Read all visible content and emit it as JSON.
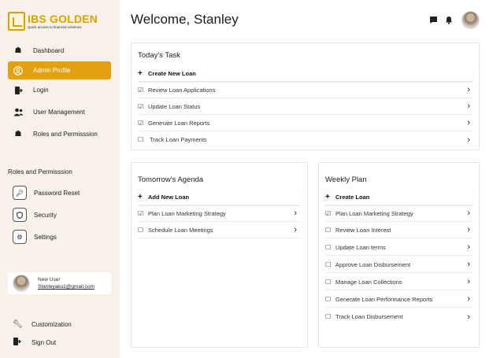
{
  "brand": {
    "title": "IBS GOLDEN",
    "tagline": "Quick access to financial solutions",
    "accent": "#e3a010"
  },
  "sidebar": {
    "items": [
      {
        "label": "Dashboard",
        "icon": "home-icon"
      },
      {
        "label": "Admin Profile",
        "icon": "user-circle-icon",
        "active": true
      },
      {
        "label": "Login",
        "icon": "login-icon"
      },
      {
        "label": "User Management",
        "icon": "users-icon"
      },
      {
        "label": "Roles and Permisssion",
        "icon": "home-icon"
      }
    ],
    "section_label": "Roles and Permisssion",
    "sub_items": [
      {
        "label": "Password Reset",
        "icon": "key-icon"
      },
      {
        "label": "Security",
        "icon": "shield-icon"
      },
      {
        "label": "Settings",
        "icon": "gear-icon"
      }
    ],
    "user": {
      "name": "New User",
      "email": "Stanleyaku1@gmail.com"
    },
    "bottom_items": [
      {
        "label": "Customization",
        "icon": "wrench-icon"
      },
      {
        "label": "Sign Out",
        "icon": "logout-icon"
      }
    ]
  },
  "header": {
    "welcome": "Welcome, Stanley"
  },
  "today": {
    "title": "Today's Task",
    "create": "Create New Loan",
    "tasks": [
      {
        "label": "Review Loan Applications",
        "checked": true
      },
      {
        "label": "Update Loan Status",
        "checked": true
      },
      {
        "label": "Generate Loan Reports",
        "checked": true
      },
      {
        "label": "Track Loan Payments",
        "checked": false
      }
    ]
  },
  "tomorrow": {
    "title": "Tomorrow's Agenda",
    "create": "Add New Loan",
    "tasks": [
      {
        "label": "Plan Loan Marketing Strategy",
        "checked": true
      },
      {
        "label": "Schedule Loan Meetings",
        "checked": false
      }
    ]
  },
  "weekly": {
    "title": "Weekly Plan",
    "create": "Create Loan",
    "tasks": [
      {
        "label": "Plan Loan Marketing Strategy",
        "checked": true
      },
      {
        "label": "Review Loan Interest",
        "checked": false
      },
      {
        "label": "Update Loan terms",
        "checked": false
      },
      {
        "label": "Approve Loan Disbursement",
        "checked": false
      },
      {
        "label": "Manage Loan Collections",
        "checked": false
      },
      {
        "label": "Generate Loan Performance Reports",
        "checked": false
      },
      {
        "label": "Track Loan Disbursement",
        "checked": false
      }
    ]
  }
}
